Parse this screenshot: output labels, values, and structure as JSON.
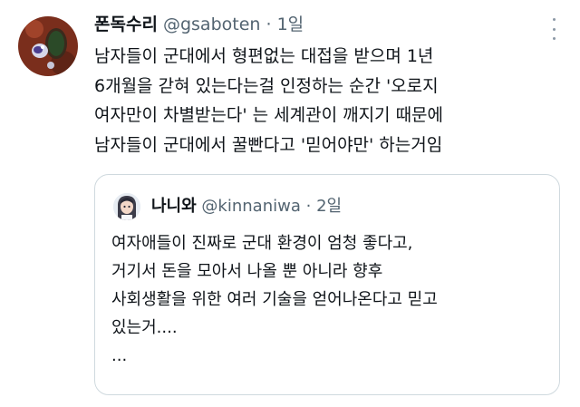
{
  "tweet": {
    "display_name": "폰독수리",
    "handle": "@gsaboten",
    "separator": "·",
    "time": "1일",
    "text": "남자들이 군대에서 형편없는 대접을 받으며 1년\n6개월을 갇혀 있는다는걸 인정하는 순간 '오로지\n여자만이 차별받는다' 는 세계관이 깨지기 때문에\n남자들이 군대에서 꿀빤다고 '믿어야만' 하는거임",
    "avatar_icon": "cactus-avatar-icon",
    "more_icon": "more-options-icon"
  },
  "quote": {
    "display_name": "나니와",
    "handle": "@kinnaniwa",
    "separator": "·",
    "time": "2일",
    "text": "여자애들이 진짜로 군대 환경이 엄청 좋다고,\n거기서 돈을 모아서 나올 뿐 아니라 향후\n사회생활을 위한 여러 기술을 얻어나온다고 믿고\n있는거....\n...",
    "avatar_icon": "anime-avatar-icon"
  },
  "colors": {
    "text": "#0f1419",
    "secondary": "#536471",
    "border": "#cfd9de"
  }
}
